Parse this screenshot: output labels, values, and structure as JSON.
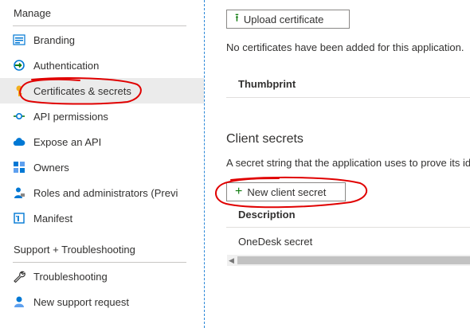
{
  "sidebar": {
    "manage_title": "Manage",
    "items": [
      {
        "label": "Branding",
        "icon": "branding-icon"
      },
      {
        "label": "Authentication",
        "icon": "authentication-icon"
      },
      {
        "label": "Certificates & secrets",
        "icon": "key-icon",
        "selected": true
      },
      {
        "label": "API permissions",
        "icon": "api-permissions-icon"
      },
      {
        "label": "Expose an API",
        "icon": "cloud-icon"
      },
      {
        "label": "Owners",
        "icon": "owners-icon"
      },
      {
        "label": "Roles and administrators (Previ",
        "icon": "roles-icon"
      },
      {
        "label": "Manifest",
        "icon": "manifest-icon"
      }
    ],
    "support_title": "Support + Troubleshooting",
    "support_items": [
      {
        "label": "Troubleshooting",
        "icon": "wrench-icon"
      },
      {
        "label": "New support request",
        "icon": "support-person-icon"
      }
    ]
  },
  "certificates": {
    "upload_label": "Upload certificate",
    "empty_message": "No certificates have been added for this application.",
    "column_thumbprint": "Thumbprint"
  },
  "client_secrets": {
    "heading": "Client secrets",
    "description": "A secret string that the application uses to prove its id",
    "new_label": "New client secret",
    "column_description": "Description",
    "rows": [
      {
        "description": "OneDesk secret"
      }
    ]
  },
  "colors": {
    "accent": "#0078d4",
    "add_glyph": "#107c10",
    "annotation": "#e00000",
    "selected_bg": "#ebebeb"
  }
}
